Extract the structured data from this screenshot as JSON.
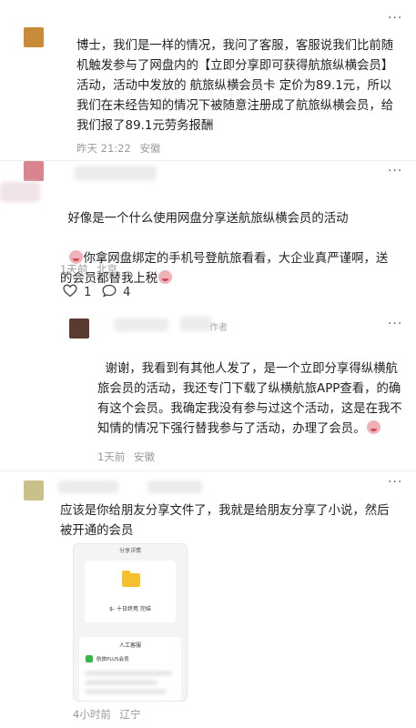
{
  "comments": [
    {
      "text": "博士，我们是一样的情况，我问了客服，客服说我们比前随机触发参与了网盘内的【立即分享即可获得航旅纵横会员】活动，活动中发放的 航旅纵横会员卡 定价为89.1元，所以我们在未经告知的情况下被随意注册成了航旅纵横会员，给我们报了89.1元劳务报酬",
      "time": "昨天 21:22",
      "location": "安徽",
      "more": "···"
    },
    {
      "text_a": "好像是一个什么使用网盘分享送航旅纵横会员的活动",
      "text_b": "你拿网盘绑定的手机号登航旅看看，大企业真严谨啊，送的会员都替我上税",
      "time": "1天前",
      "location": "北京",
      "likes": "1",
      "replies": "4",
      "more": "···"
    },
    {
      "author_tag": "作者",
      "text": "谢谢，我看到有其他人发了，是一个立即分享得纵横航旅会员的活动，我还专门下载了纵横航旅APP查看，的确有这个会员。我确定我没有参与过这个活动，这是在我不知情的情况下强行替我参与了活动，办理了会员。",
      "time": "1天前",
      "location": "安徽",
      "more": "···"
    },
    {
      "text": "应该是你给朋友分享文件了，我就是给朋友分享了小说，然后被开通的会员",
      "time": "4小时前",
      "location": "辽宁",
      "more": "···",
      "screenshot": {
        "header": "分享详情",
        "file_name": "$- 十日终焉 完结",
        "service_title": "人工客服",
        "item_name": "航旅PLUS会员"
      }
    }
  ],
  "colors": {
    "meta": "#9a9a9a",
    "folder": "#f6c02c",
    "avatar_orange": "#c98a3a",
    "avatar_pink": "#d9848e",
    "avatar_dark": "#5a3b33",
    "avatar_olive": "#c9c08a"
  },
  "icons": {
    "like": "heart-outline-icon",
    "reply": "speech-bubble-icon",
    "more": "more-dots-icon"
  }
}
